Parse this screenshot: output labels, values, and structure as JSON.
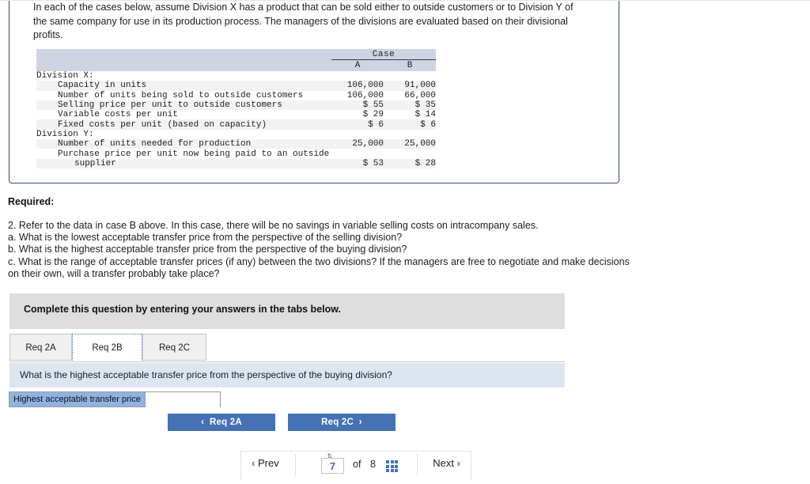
{
  "problem": {
    "intro": "In each of the cases below, assume Division X has a product that can be sold either to outside customers or to Division Y of the same company for use in its production process. The managers of the divisions are evaluated based on their divisional profits."
  },
  "table": {
    "group_header": "Case",
    "columns": [
      "A",
      "B"
    ],
    "rows": [
      {
        "label": "Division X:",
        "indent": 0,
        "a": "",
        "b": ""
      },
      {
        "label": "Capacity in units",
        "indent": 1,
        "a": "106,000",
        "b": "91,000"
      },
      {
        "label": "Number of units being sold to outside customers",
        "indent": 1,
        "a": "106,000",
        "b": "66,000"
      },
      {
        "label": "Selling price per unit to outside customers",
        "indent": 1,
        "a": "$ 55",
        "b": "$ 35"
      },
      {
        "label": "Variable costs per unit",
        "indent": 1,
        "a": "$ 29",
        "b": "$ 14"
      },
      {
        "label": "Fixed costs per unit (based on capacity)",
        "indent": 1,
        "a": "$ 6",
        "b": "$ 6"
      },
      {
        "label": "Division Y:",
        "indent": 0,
        "a": "",
        "b": ""
      },
      {
        "label": "Number of units needed for production",
        "indent": 1,
        "a": "25,000",
        "b": "25,000"
      },
      {
        "label": "Purchase price per unit now being paid to an outside",
        "indent": 1,
        "a": "",
        "b": ""
      },
      {
        "label": "supplier",
        "indent": 2,
        "a": "$ 53",
        "b": "$ 28"
      }
    ]
  },
  "required": {
    "heading": "Required:",
    "lines": [
      "2. Refer to the data in case B above. In this case, there will be no savings in variable selling costs on intracompany sales.",
      "a. What is the lowest acceptable transfer price from the perspective of the selling division?",
      "b. What is the highest acceptable transfer price from the perspective of the buying division?",
      "c. What is the range of acceptable transfer prices (if any) between the two divisions? If the managers are free to negotiate and make decisions on their own, will a transfer probably take place?"
    ]
  },
  "answer_card": {
    "banner": "Complete this question by entering your answers in the tabs below.",
    "tabs": [
      {
        "label": "Req 2A",
        "active": false
      },
      {
        "label": "Req 2B",
        "active": true
      },
      {
        "label": "Req 2C",
        "active": false
      }
    ],
    "question": "What is the highest acceptable transfer price from the perspective of the buying division?",
    "field_label": "Highest acceptable transfer price",
    "field_value": "",
    "field_placeholder": "",
    "prev_button": "Req 2A",
    "next_button": "Req 2C",
    "prev_chevron": "‹",
    "next_chevron": "›"
  },
  "pager": {
    "prev_label": "Prev",
    "next_label": "Next",
    "prev_chevron": "‹",
    "next_chevron": "›",
    "current_page": "7",
    "of_label": "of",
    "total_pages": "8"
  },
  "colors": {
    "panel_border": "#2b4a7d",
    "table_header_bg": "#ced4e2",
    "banner_bg": "#dedede",
    "question_bg": "#dce6f1",
    "field_label_bg": "#8fb4e3",
    "button_blue": "#4472b4",
    "link_blue": "#3a6fb5"
  }
}
